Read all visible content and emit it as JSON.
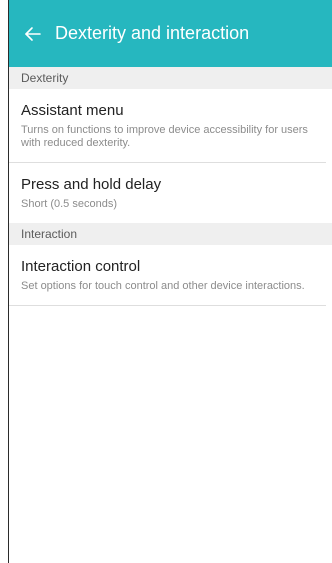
{
  "header": {
    "title": "Dexterity and interaction",
    "back_icon": "arrow-left-icon",
    "color": "#26b7bf"
  },
  "sections": [
    {
      "label": "Dexterity",
      "items": [
        {
          "title": "Assistant menu",
          "subtitle": "Turns on functions to improve device accessibility for users with reduced dexterity."
        },
        {
          "title": "Press and hold delay",
          "subtitle": "Short (0.5 seconds)"
        }
      ]
    },
    {
      "label": "Interaction",
      "items": [
        {
          "title": "Interaction control",
          "subtitle": "Set options for touch control and other device interactions."
        }
      ]
    }
  ]
}
